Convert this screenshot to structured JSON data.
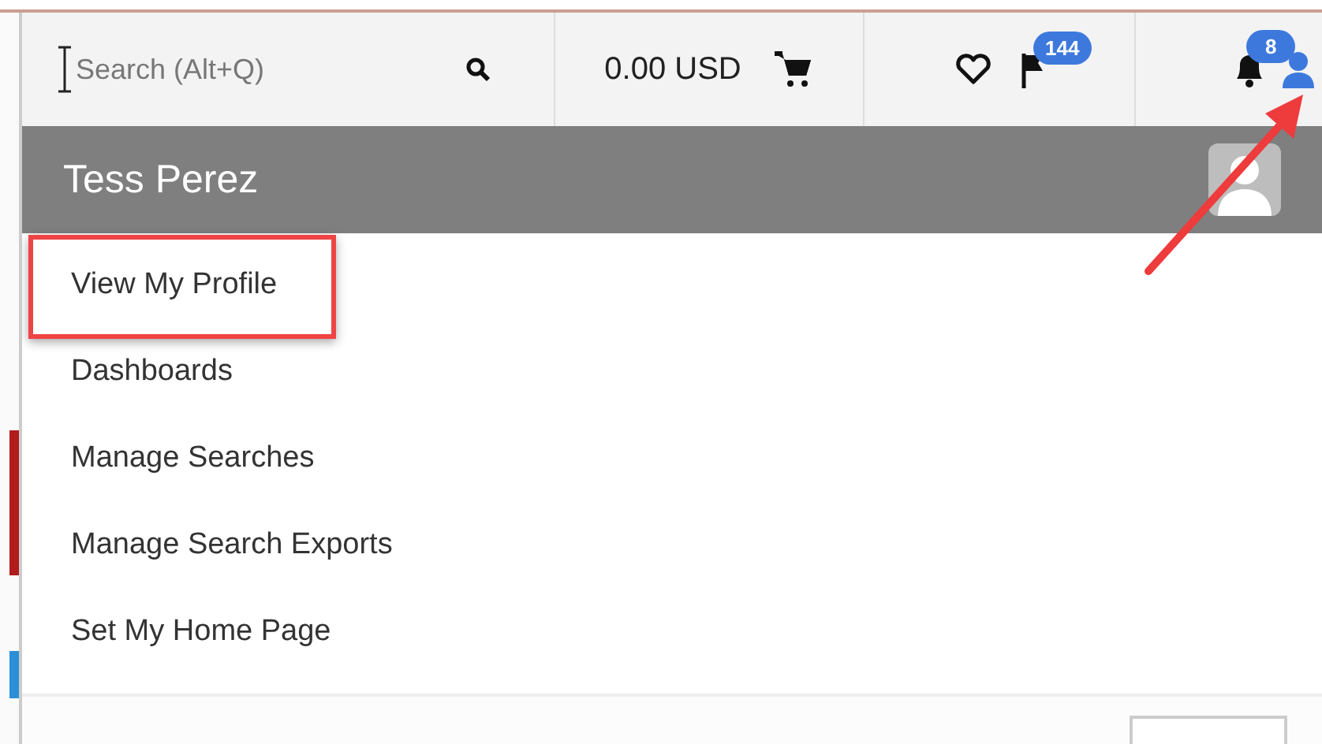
{
  "search": {
    "placeholder": "Search (Alt+Q)"
  },
  "cart": {
    "amount": "0.00 USD"
  },
  "flags": {
    "badge": "144"
  },
  "notifications": {
    "badge": "8"
  },
  "user": {
    "name": "Tess Perez"
  },
  "menu": [
    {
      "label": "View My Profile",
      "highlighted": true
    },
    {
      "label": "Dashboards",
      "highlighted": false
    },
    {
      "label": "Manage Searches",
      "highlighted": false
    },
    {
      "label": "Manage Search Exports",
      "highlighted": false
    },
    {
      "label": "Set My Home Page",
      "highlighted": false
    }
  ]
}
